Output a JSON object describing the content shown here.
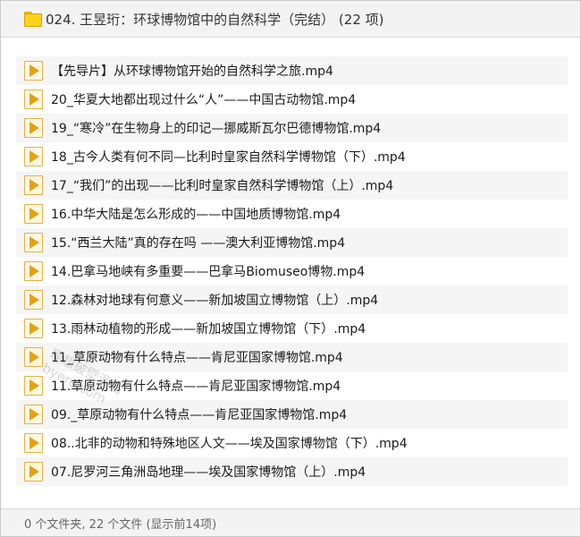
{
  "window": {
    "title": "024. 王昱珩：环球博物馆中的自然科学（完结） (22 项)"
  },
  "files": [
    {
      "name": "【先导片】从环球博物馆开始的自然科学之旅.mp4"
    },
    {
      "name": "20_华夏大地都出现过什么“人”——中国古动物馆.mp4"
    },
    {
      "name": "19_“寒冷”在生物身上的印记—挪威斯瓦尔巴德博物馆.mp4"
    },
    {
      "name": "18_古今人类有何不同—比利时皇家自然科学博物馆（下）.mp4"
    },
    {
      "name": "17_“我们”的出现——比利时皇家自然科学博物馆（上）.mp4"
    },
    {
      "name": "16.中华大陆是怎么形成的——中国地质博物馆.mp4"
    },
    {
      "name": "15.“西兰大陆”真的存在吗 ——澳大利亚博物馆.mp4"
    },
    {
      "name": "14.巴拿马地峡有多重要——巴拿马Biomuseo博物.mp4"
    },
    {
      "name": "12.森林对地球有何意义——新加坡国立博物馆（上）.mp4"
    },
    {
      "name": "13.雨林动植物的形成——新加坡国立博物馆（下）.mp4"
    },
    {
      "name": "11_草原动物有什么特点——肯尼亚国家博物馆.mp4"
    },
    {
      "name": "11.草原动物有什么特点——肯尼亚国家博物馆.mp4"
    },
    {
      "name": "09._草原动物有什么特点——肯尼亚国家博物馆.mp4"
    },
    {
      "name": "08..北非的动物和特殊地区人文——埃及国家博物馆（下）.mp4"
    },
    {
      "name": "07.尼罗河三角洲岛地理——埃及国家博物馆（上）.mp4"
    }
  ],
  "status": {
    "text": "0 个文件夹, 22 个文件 (显示前14项)"
  },
  "watermark": {
    "line1": "理想破壁源站",
    "line2": "byerc.com"
  },
  "icons": {
    "title": "folder-icon",
    "file": "video-file-icon"
  },
  "colors": {
    "folder": "#ffd21f",
    "file_icon": "#e2a11a",
    "row_stripe": "#f5f5f5"
  }
}
